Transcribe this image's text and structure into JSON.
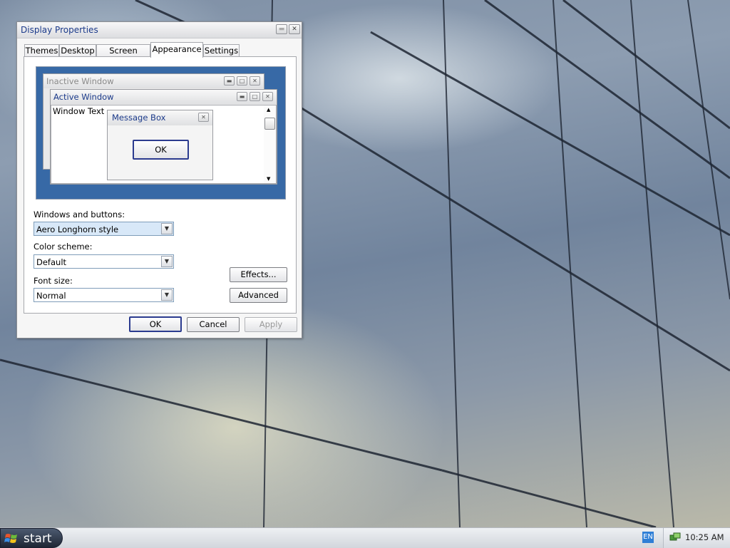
{
  "window": {
    "title": "Display Properties",
    "title_buttons": [
      "help-icon",
      "close-icon"
    ]
  },
  "tabs": [
    {
      "label": "Themes",
      "active": false
    },
    {
      "label": "Desktop",
      "active": false
    },
    {
      "label": "Screen Saver",
      "active": false
    },
    {
      "label": "Appearance",
      "active": true
    },
    {
      "label": "Settings",
      "active": false
    }
  ],
  "preview": {
    "inactive_title": "Inactive Window",
    "active_title": "Active Window",
    "window_text": "Window Text",
    "message_box_title": "Message Box",
    "message_box_ok": "OK"
  },
  "appearance": {
    "windows_buttons_label": "Windows and buttons:",
    "windows_buttons_value": "Aero Longhorn style",
    "color_scheme_label": "Color scheme:",
    "color_scheme_value": "Default",
    "font_size_label": "Font size:",
    "font_size_value": "Normal",
    "effects_button": "Effects...",
    "advanced_button": "Advanced"
  },
  "dialog_buttons": {
    "ok": "OK",
    "cancel": "Cancel",
    "apply": "Apply",
    "apply_enabled": false
  },
  "taskbar": {
    "start_label": "start",
    "language": "EN",
    "clock": "10:25 AM"
  },
  "colors": {
    "preview_background": "#3769a6",
    "active_title_text": "#1b3a8a",
    "selected_combo": "#d8e8f8"
  }
}
